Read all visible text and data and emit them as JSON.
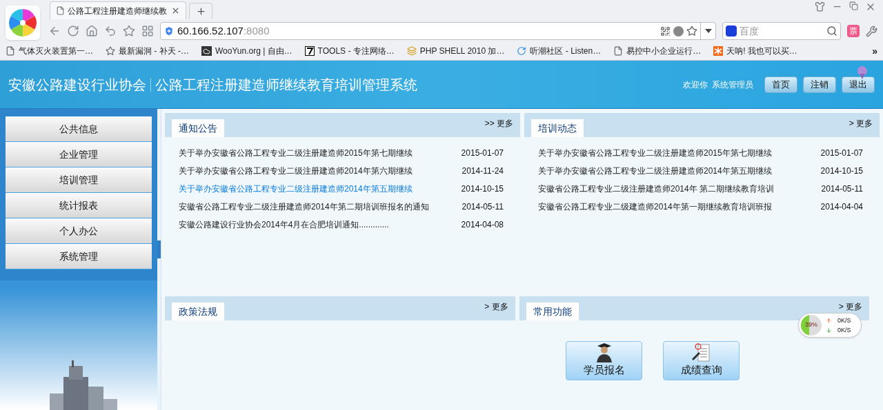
{
  "browser": {
    "tab_title": "公路工程注册建造师继续教",
    "url_host": "60.166.52.107",
    "url_port": ":8080",
    "search_placeholder": "百度",
    "ticket_label": "票",
    "bookmarks": [
      {
        "kind": "page",
        "label": "气体灭火装置第一…"
      },
      {
        "kind": "star",
        "label": "最新漏洞 - 补天 -…"
      },
      {
        "kind": "cloud",
        "label": "WooYun.org | 自由…"
      },
      {
        "kind": "seven",
        "label": "TOOLS - 专注网络…"
      },
      {
        "kind": "layers",
        "label": "PHP SHELL 2010 加…"
      },
      {
        "kind": "swirl",
        "label": "听潮社区 - Listen…"
      },
      {
        "kind": "page",
        "label": "易控中小企业运行…"
      },
      {
        "kind": "mi",
        "label": "天呐! 我也可以买…"
      }
    ],
    "overflow": "»"
  },
  "header": {
    "org": "安徽公路建设行业协会",
    "system": "公路工程注册建造师继续教育培训管理系统",
    "welcome": "欢迎你",
    "user": "系统管理员",
    "buttons": [
      "首页",
      "注销",
      "退出"
    ]
  },
  "sidebar": {
    "items": [
      "公共信息",
      "企业管理",
      "培训管理",
      "统计报表",
      "个人办公",
      "系统管理"
    ]
  },
  "panels": [
    {
      "title": "通知公告",
      "more_arrow": ">>",
      "more": "更多",
      "items": [
        {
          "title": "关于举办安徽省公路工程专业二级注册建造师2015年第七期继续",
          "date": "2015-01-07",
          "highlighted": false
        },
        {
          "title": "关于举办安徽省公路工程专业二级注册建造师2014年第六期继续",
          "date": "2014-11-24",
          "highlighted": false
        },
        {
          "title": "关于举办安徽省公路工程专业二级注册建造师2014年第五期继续",
          "date": "2014-10-15",
          "highlighted": true
        },
        {
          "title": "安徽省公路工程专业二级注册建造师2014年第二期培训班报名的通知",
          "date": "2014-05-11",
          "highlighted": false
        },
        {
          "title": "安徽公路建设行业协会2014年4月在合肥培训通知.............",
          "date": "2014-04-08",
          "highlighted": false
        }
      ]
    },
    {
      "title": "培训动态",
      "more_arrow": ">",
      "more": "更多",
      "items": [
        {
          "title": "关于举办安徽省公路工程专业二级注册建造师2015年第七期继续",
          "date": "2015-01-07",
          "highlighted": false
        },
        {
          "title": "关于举办安徽省公路工程专业二级注册建造师2014年第五期继续",
          "date": "2014-10-15",
          "highlighted": false
        },
        {
          "title": "安徽省公路工程专业二级注册建造师2014年 第二期继续教育培训",
          "date": "2014-05-11",
          "highlighted": false
        },
        {
          "title": "安徽省公路工程专业二级建造师2014年第一期继续教育培训班报",
          "date": "2014-04-04",
          "highlighted": false
        }
      ]
    },
    {
      "title": "政策法规",
      "more_arrow": ">",
      "more": "更多"
    },
    {
      "title": "常用功能",
      "more_arrow": ">",
      "more": "更多",
      "functions": [
        {
          "kind": "student",
          "label": "学员报名"
        },
        {
          "kind": "grades",
          "label": "成绩查询"
        }
      ]
    }
  ],
  "speed_widget": {
    "percent": "39%",
    "level": 0.39,
    "up": "0K/S",
    "down": "0K/S"
  }
}
